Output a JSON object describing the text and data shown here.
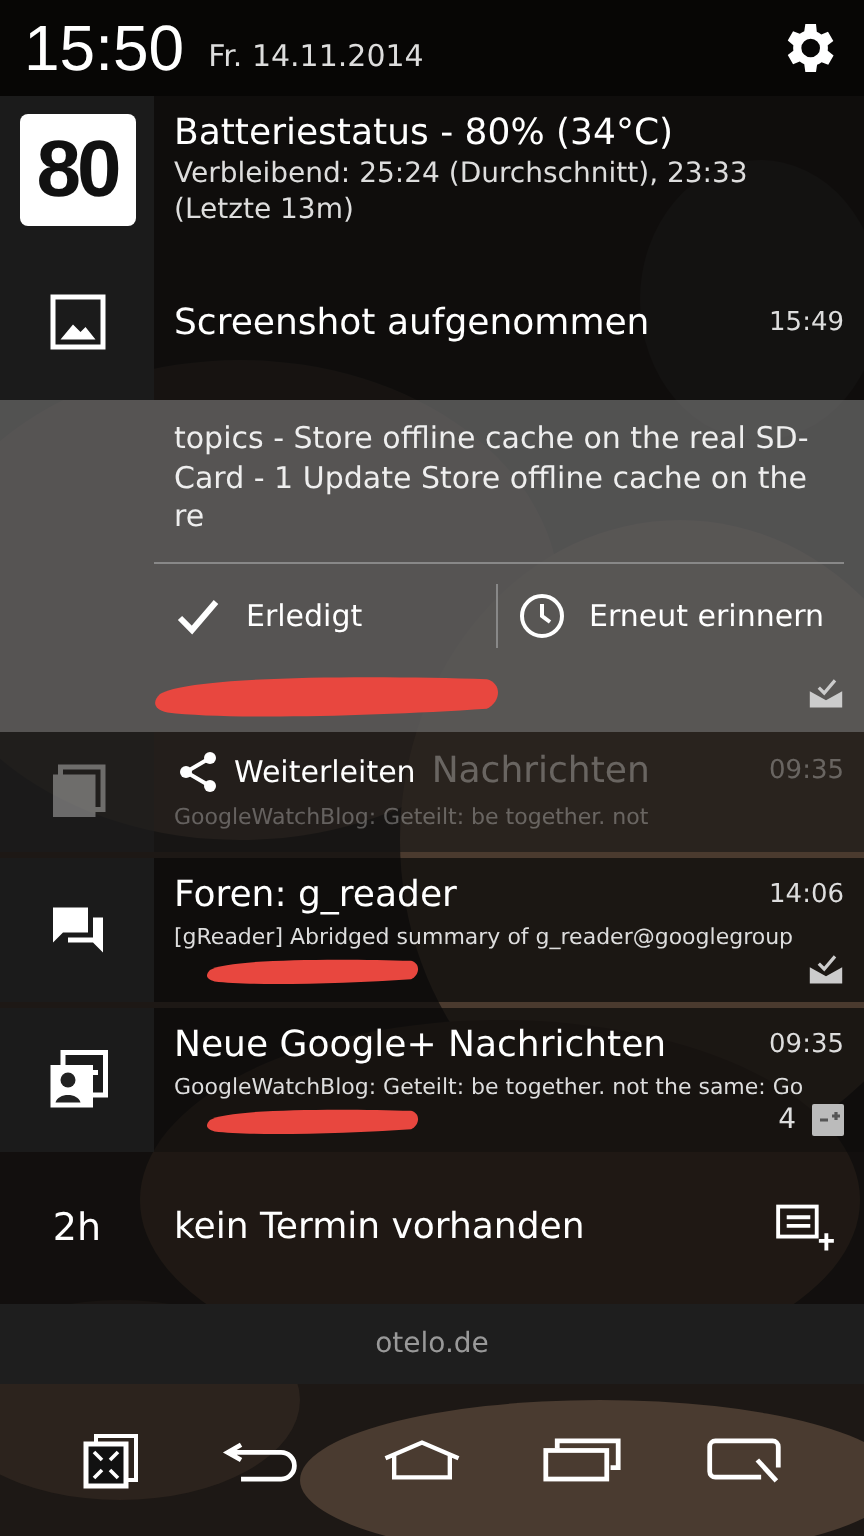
{
  "status_bar": {
    "time": "15:50",
    "date": "Fr. 14.11.2014"
  },
  "battery": {
    "icon_text": "80",
    "title": "Batteriestatus - 80% (34°C)",
    "text": "Verbleibend: 25:24 (Durchschnitt), 23:33 (Letzte 13m)"
  },
  "screenshot": {
    "title": "Screenshot aufgenommen",
    "time": "15:49"
  },
  "expanded": {
    "text": "topics - Store offline cache on the real SD-Card - 1 Update Store offline cache on the re",
    "redacted": true,
    "actions": [
      {
        "kind": "done",
        "label": "Erledigt"
      },
      {
        "kind": "snooze",
        "label": "Erneut erinnern"
      }
    ]
  },
  "swiped": {
    "action": "Weiterleiten",
    "title": "Nachrichten",
    "time": "09:35",
    "text": "GoogleWatchBlog: Geteilt: be together. not"
  },
  "notifications": [
    {
      "kind": "forum",
      "title": "Foren: g_reader",
      "time": "14:06",
      "text": "[gReader] Abridged summary of g_reader@googlegroup",
      "redacted": true
    },
    {
      "kind": "gplus",
      "title": "Neue Google+ Nachrichten",
      "time": "09:35",
      "text": "GoogleWatchBlog: Geteilt: be together. not the same: Go",
      "redacted": true,
      "count": "4"
    }
  ],
  "calendar": {
    "time": "2h",
    "text": "kein Termin vorhanden"
  },
  "carrier": "otelo.de"
}
